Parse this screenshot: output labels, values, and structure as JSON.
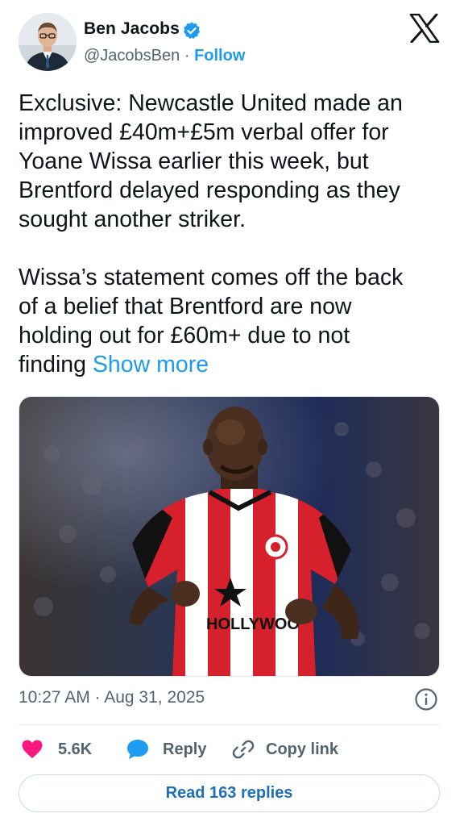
{
  "tweet": {
    "author": {
      "name": "Ben Jacobs",
      "handle": "@JacobsBen",
      "separator": "·",
      "follow_label": "Follow",
      "verified": true
    },
    "platform_icon": "x-logo-icon",
    "text": {
      "paragraph1": "Exclusive: Newcastle United made an\nimproved £40m+£5m verbal offer for\nYoane Wissa earlier this week, but\nBrentford delayed responding as they\nsought another striker.",
      "paragraph2": "Wissa’s statement comes off the back\nof a belief that Brentford are now\nholding out for £60m+ due to not\nfinding ",
      "show_more_label": "Show more"
    },
    "media": {
      "shirt_text": "HOLLYWOO",
      "kit_colors": [
        "#d6202c",
        "#ffffff",
        "#111111"
      ]
    },
    "timestamp": "10:27 AM · Aug 31, 2025",
    "actions": {
      "like_count": "5.6K",
      "reply_label": "Reply",
      "copy_link_label": "Copy link",
      "read_replies_label": "Read 163 replies"
    },
    "colors": {
      "accent": "#1d9bf0",
      "like": "#f91880",
      "secondary_text": "#536471"
    }
  }
}
